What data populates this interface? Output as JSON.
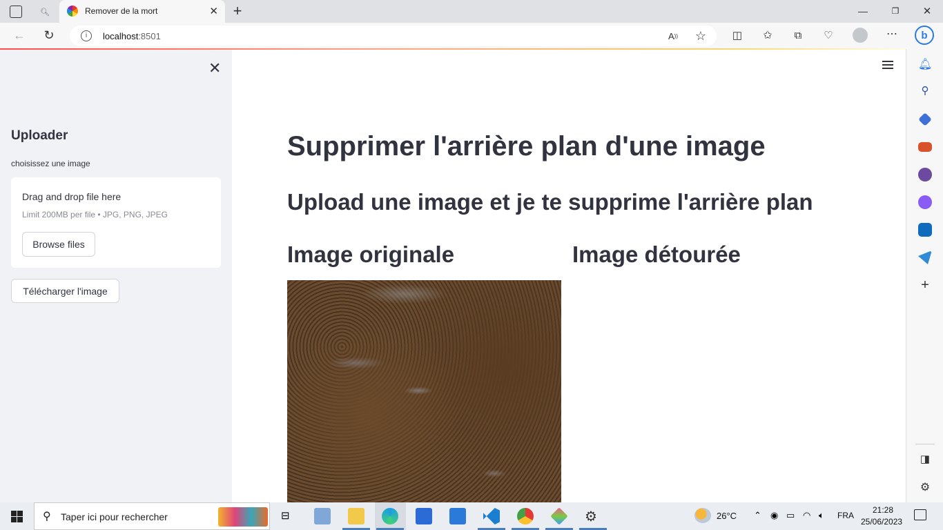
{
  "browser": {
    "tab_title": "Remover de la mort",
    "url_host": "localhost",
    "url_port": ":8501"
  },
  "sidebar": {
    "heading": "Uploader",
    "uploader_label": "choisissez une image",
    "dropzone_title": "Drag and drop file here",
    "dropzone_limit": "Limit 200MB per file • JPG, PNG, JPEG",
    "browse_label": "Browse files",
    "download_label": "Télécharger l'image"
  },
  "main": {
    "title": "Supprimer l'arrière plan d'une image",
    "subtitle": "Upload une image et je te supprime l'arrière plan",
    "col_original": "Image originale",
    "col_result": "Image détourée"
  },
  "taskbar": {
    "search_placeholder": "Taper ici pour rechercher",
    "weather": "26°C",
    "language": "FRA",
    "time": "21:28",
    "date": "25/06/2023"
  }
}
